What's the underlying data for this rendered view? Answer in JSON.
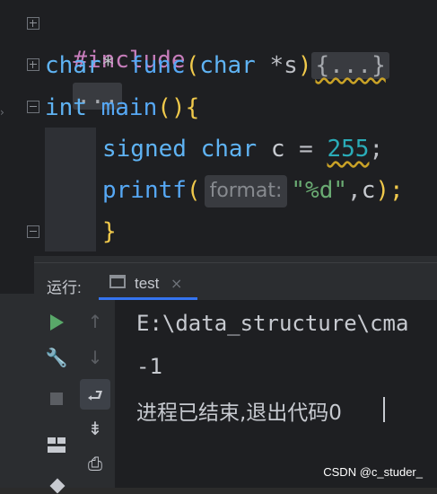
{
  "editor": {
    "line1": {
      "directive": "#include",
      "folded": "..."
    },
    "line2": {
      "type": "char",
      "star": "*",
      "space": " ",
      "fn": "func",
      "open": "(",
      "param_type": "char",
      "param": "*s",
      "close": ")",
      "folded": "{...}"
    },
    "line3": {
      "type": "int",
      "fn": "main",
      "parens": "()",
      "brace": "{"
    },
    "line4": {
      "kw1": "signed",
      "kw2": "char",
      "var": "c",
      "op": "=",
      "value": "255",
      "semi": ";"
    },
    "line5": {
      "fn": "printf",
      "open": "(",
      "hint": "format:",
      "str": "\"%d\"",
      "comma": ",",
      "arg": "c",
      "close": ");"
    },
    "line6": {
      "brace": "}"
    }
  },
  "panel": {
    "run_label": "运行:",
    "tab_label": "test",
    "tab_close": "×"
  },
  "console": {
    "lines": [
      "E:\\data_structure\\cma",
      "-1",
      "进程已结束,退出代码0"
    ]
  },
  "watermark": "CSDN @c_studer_",
  "icons": {
    "run": "play-icon",
    "up": "arrow-up-icon",
    "wrench": "wrench-icon",
    "down": "arrow-down-icon",
    "stop": "stop-icon",
    "wrap": "soft-wrap-icon",
    "layout": "layout-icon",
    "scroll": "scroll-to-end-icon",
    "print": "print-icon",
    "pin": "pin-icon"
  }
}
